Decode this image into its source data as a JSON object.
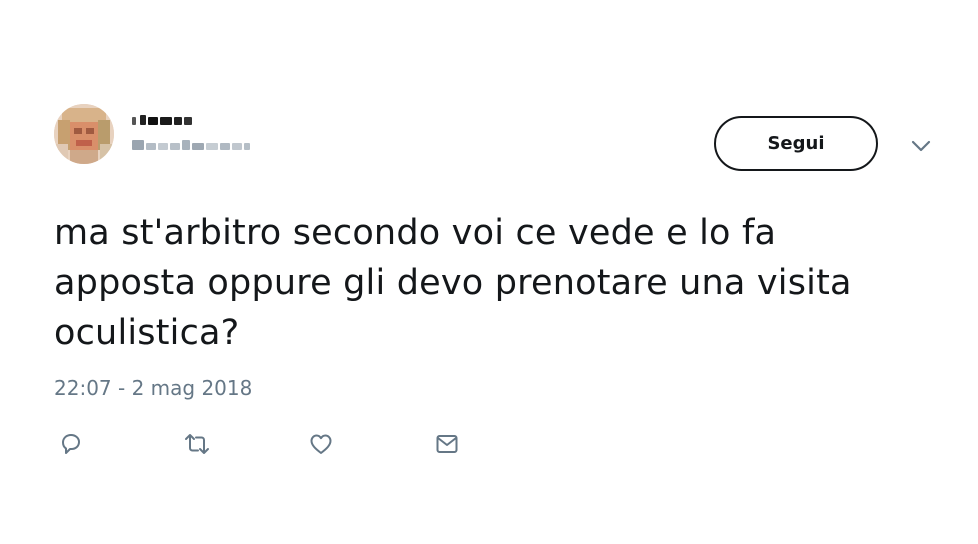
{
  "tweet": {
    "follow_label": "Segui",
    "text": "ma st'arbitro secondo voi ce vede e lo fa apposta oppure gli devo prenotare una visita oculistica?",
    "text_lines": [
      "ma st'arbitro secondo voi ce vede e lo fa",
      "apposta oppure gli devo prenotare una visita",
      "oculistica?"
    ],
    "timestamp": "22:07 - 2 mag 2018"
  },
  "icons": {
    "reply": "reply-icon",
    "retweet": "retweet-icon",
    "like": "heart-icon",
    "message": "envelope-icon",
    "menu": "chevron-down-icon"
  },
  "colors": {
    "text": "#14171a",
    "muted": "#657786",
    "border": "#14171a",
    "background": "#ffffff"
  }
}
